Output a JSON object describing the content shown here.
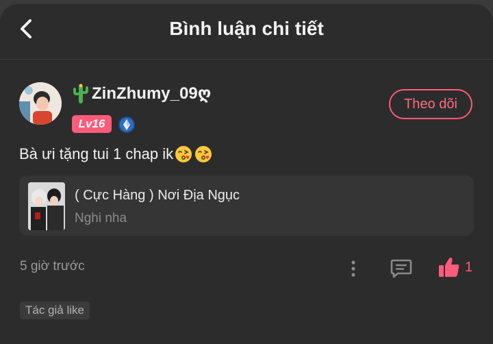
{
  "header": {
    "title": "Bình luận chi tiết"
  },
  "comment": {
    "username": "ZinZhumy_09ღ",
    "level": "Lv16",
    "follow_label": "Theo dõi",
    "text": "Bà ưi tặng tui 1 chap ik",
    "time": "5 giờ trước",
    "like_count": "1",
    "author_tag": "Tác giả like"
  },
  "book": {
    "title": "( Cực Hàng ) Nơi Địa Ngục",
    "subtitle": "Nghi nha"
  },
  "colors": {
    "background": "#2c2c2c",
    "accent": "#ff5b7a",
    "card": "#353535",
    "muted_text": "#9a9a9a"
  },
  "icons": [
    "back-arrow-icon",
    "cactus-icon",
    "verified-icon",
    "kiss-emoji-icon",
    "more-vertical-icon",
    "comment-icon",
    "thumbs-up-icon"
  ]
}
